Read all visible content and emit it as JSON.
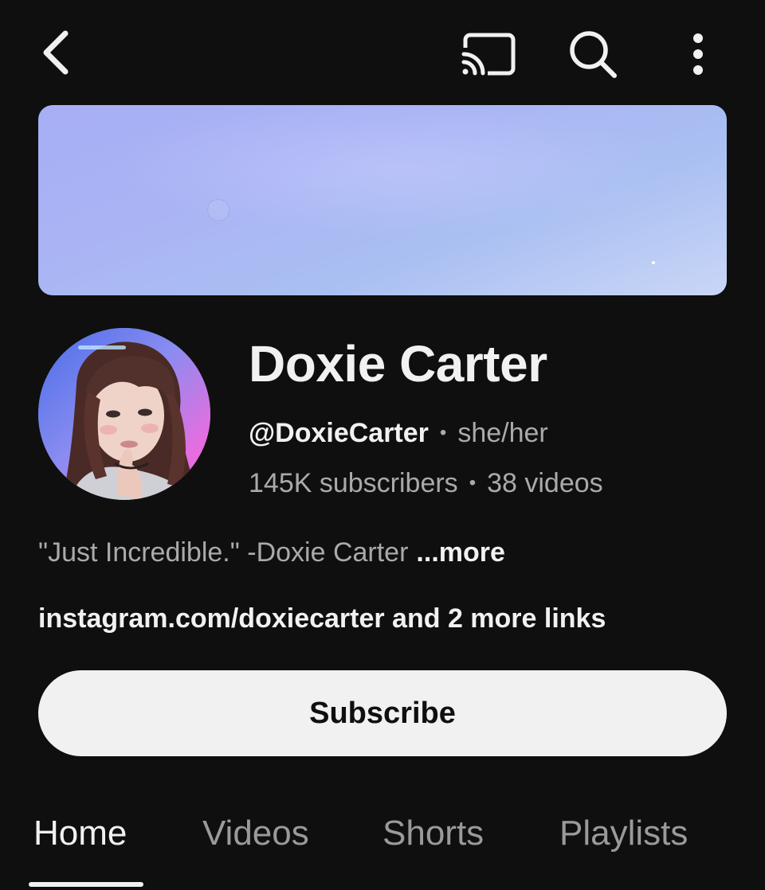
{
  "header": {
    "back_icon": "chevron-left-icon",
    "cast_icon": "cast-icon",
    "search_icon": "search-icon",
    "more_icon": "vertical-dots-icon"
  },
  "channel": {
    "name": "Doxie Carter",
    "handle": "@DoxieCarter",
    "pronouns": "she/her",
    "subscribers": "145K subscribers",
    "videos": "38 videos",
    "description": "\"Just Incredible.\" -Doxie Carter",
    "description_more": "...more",
    "links": "instagram.com/doxiecarter and 2 more links",
    "separator": "•"
  },
  "actions": {
    "subscribe_label": "Subscribe"
  },
  "tabs": [
    {
      "label": "Home",
      "active": true
    },
    {
      "label": "Videos",
      "active": false
    },
    {
      "label": "Shorts",
      "active": false
    },
    {
      "label": "Playlists",
      "active": false
    }
  ],
  "colors": {
    "background": "#0f0f0f",
    "text_primary": "#f1f1f1",
    "text_secondary": "#aaaaaa",
    "subscribe_bg": "#f1f1f1"
  }
}
